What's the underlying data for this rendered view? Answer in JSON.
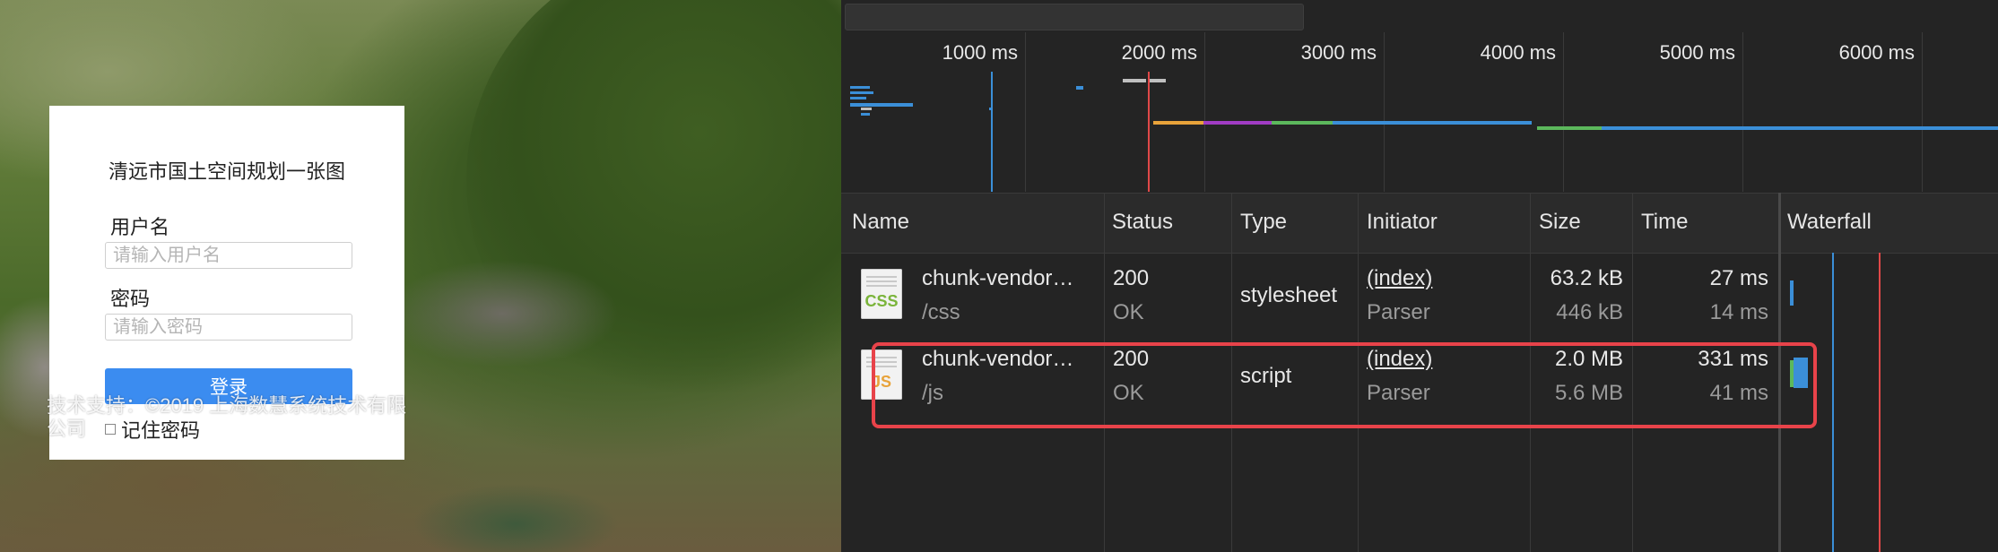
{
  "login": {
    "title": "清远市国土空间规划一张图",
    "username_label": "用户名",
    "username_placeholder": "请输入用户名",
    "password_label": "密码",
    "password_placeholder": "请输入密码",
    "login_button": "登录",
    "remember_label": "记住密码",
    "footer": "技术支持：©2019 上海数慧系统技术有限公司"
  },
  "devtools": {
    "timeline_ticks": [
      "1000 ms",
      "2000 ms",
      "3000 ms",
      "4000 ms",
      "5000 ms",
      "6000 ms"
    ],
    "columns": [
      "Name",
      "Status",
      "Type",
      "Initiator",
      "Size",
      "Time",
      "Waterfall"
    ],
    "rows": [
      {
        "icon": "css-file-icon",
        "icon_label": "CSS",
        "name": "chunk-vendor…",
        "path": "/css",
        "status_code": "200",
        "status_text": "OK",
        "type": "stylesheet",
        "initiator": "(index)",
        "initiator_detail": "Parser",
        "size": "63.2 kB",
        "resource_size": "446 kB",
        "time": "27 ms",
        "latency": "14 ms"
      },
      {
        "icon": "js-file-icon",
        "icon_label": "JS",
        "name": "chunk-vendor…",
        "path": "/js",
        "status_code": "200",
        "status_text": "OK",
        "type": "script",
        "initiator": "(index)",
        "initiator_detail": "Parser",
        "size": "2.0 MB",
        "resource_size": "5.6 MB",
        "time": "331 ms",
        "latency": "41 ms"
      }
    ],
    "colors": {
      "highlight": "#e8434a",
      "dom_content_loaded": "#3b8fd8",
      "load": "#e04848",
      "css_text": "#7ab43a",
      "js_text": "#e8a33a"
    }
  }
}
